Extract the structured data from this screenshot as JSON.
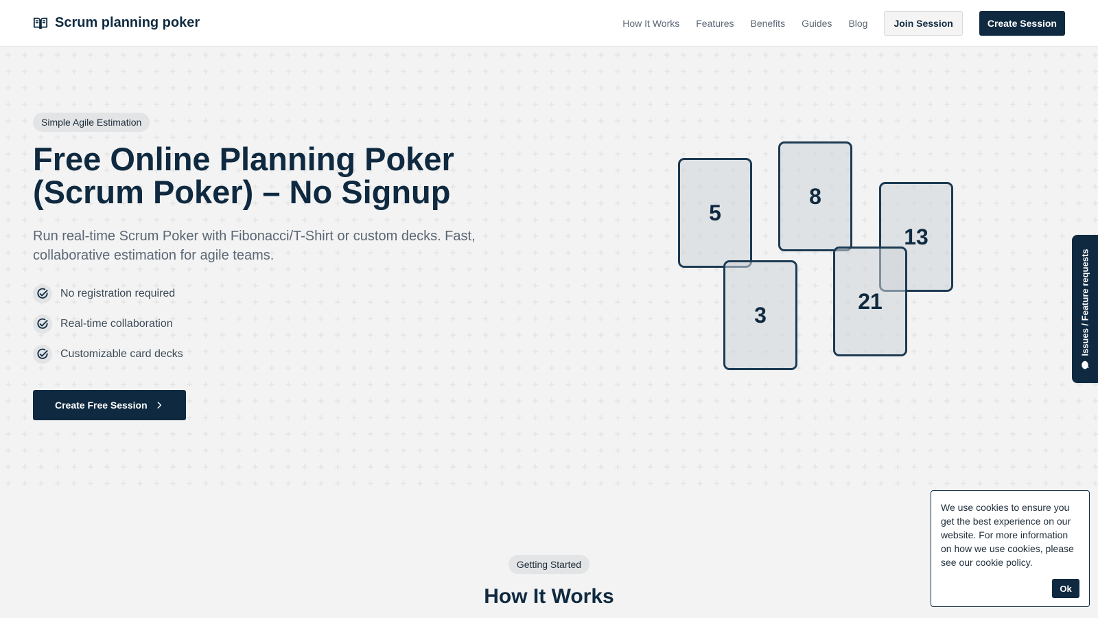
{
  "header": {
    "logo_text": "Scrum planning poker",
    "logo_icon": "book-open-icon",
    "nav": [
      "How It Works",
      "Features",
      "Benefits",
      "Guides",
      "Blog"
    ],
    "join_label": "Join Session",
    "create_label": "Create Session"
  },
  "hero": {
    "badge": "Simple Agile Estimation",
    "title": "Free Online Planning Poker (Scrum Poker) – No Signup",
    "subtitle": "Run real-time Scrum Poker with Fibonacci/T-Shirt or custom decks. Fast, collaborative estimation for agile teams.",
    "features": [
      "No registration required",
      "Real-time collaboration",
      "Customizable card decks"
    ],
    "cta_label": "Create Free Session",
    "cards": [
      "5",
      "8",
      "13",
      "3",
      "21"
    ]
  },
  "feedback_tab": {
    "label": "Issues / Feature requests",
    "icon": "chat-bubble-icon"
  },
  "section": {
    "badge": "Getting Started",
    "title": "How It Works"
  },
  "cookie": {
    "text": "We use cookies to ensure you get the best experience on our website. For more information on how we use cookies, please see our cookie policy.",
    "ok_label": "Ok"
  },
  "colors": {
    "primary": "#0f2a40",
    "background": "#f3f3f3",
    "muted_text": "#5a6775",
    "badge_bg": "#e2e4e6"
  }
}
